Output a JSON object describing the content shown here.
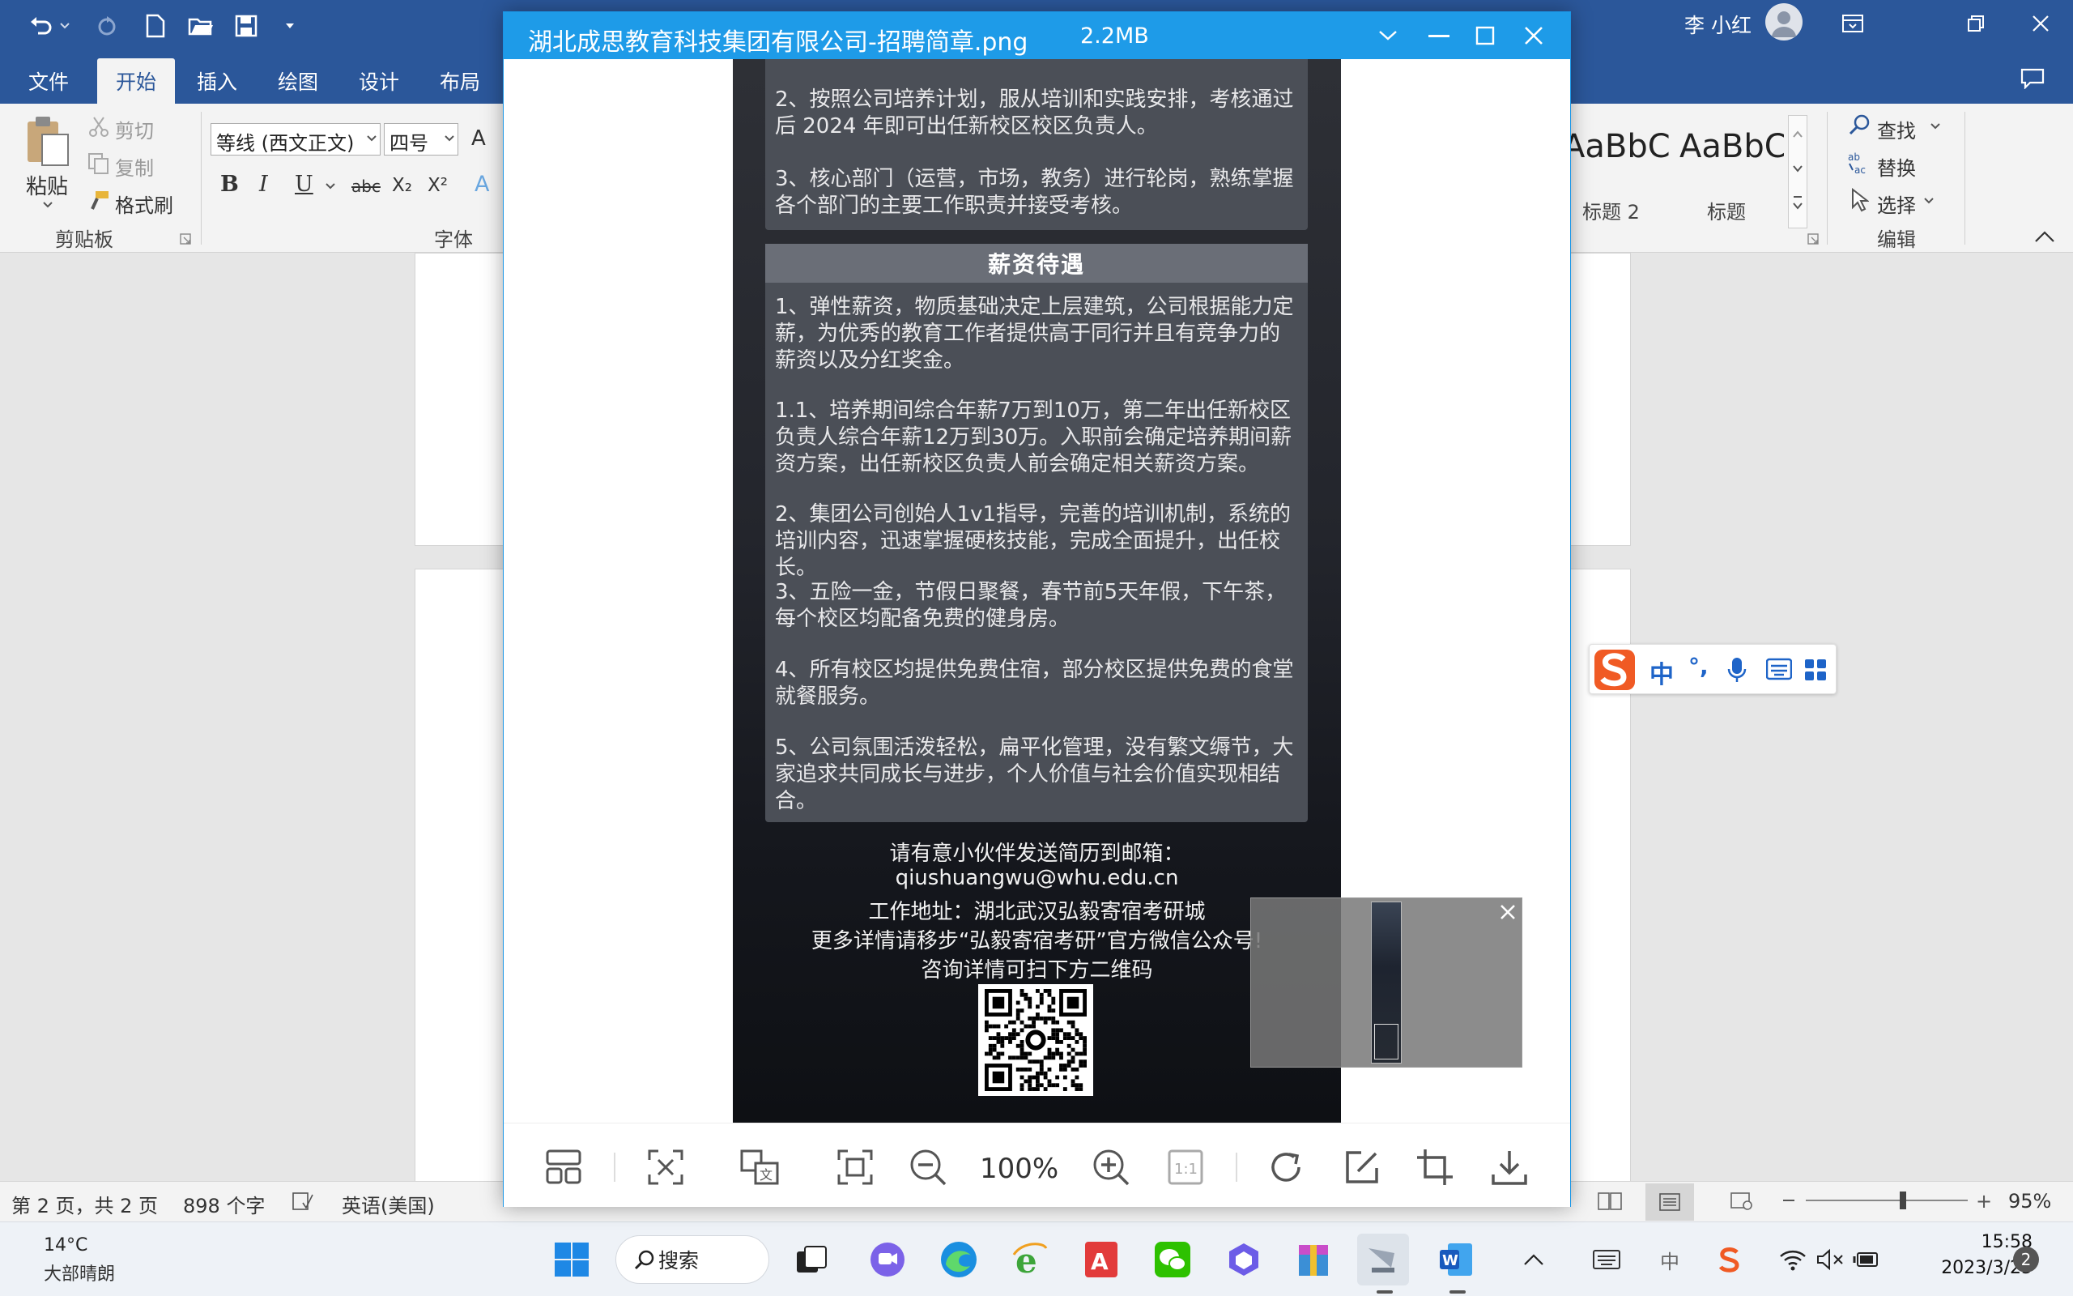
{
  "word": {
    "tabs": [
      "文件",
      "开始",
      "插入",
      "绘图",
      "设计",
      "布局"
    ],
    "active_tab": "开始",
    "user_name": "李 小红",
    "clipboard": {
      "paste": "粘贴",
      "cut": "剪切",
      "copy": "复制",
      "format_painter": "格式刷",
      "group_label": "剪贴板"
    },
    "font": {
      "font_name": "等线 (西文正文)",
      "font_size": "四号",
      "group_label": "字体",
      "grow_label": "A",
      "bold": "B",
      "italic": "I",
      "underline": "U",
      "strike": "abc",
      "sub": "X₂",
      "sup": "X²",
      "effects": "A"
    },
    "styles": [
      {
        "preview": "AaBbC",
        "name": "标题 2"
      },
      {
        "preview": "AaBbC",
        "name": "标题"
      }
    ],
    "editing": {
      "find": "查找",
      "replace": "替换",
      "select": "选择",
      "group_label": "编辑"
    }
  },
  "status": {
    "page": "第 2 页，共 2 页",
    "words": "898 个字",
    "language": "英语(美国)",
    "zoom": "95%",
    "zoom_fraction": 0.6
  },
  "viewer": {
    "title": "湖北成思教育科技集团有限公司-招聘简章.png",
    "filesize": "2.2MB",
    "zoom": "100%",
    "poster": {
      "top_items": [
        "2、按照公司培养计划，服从培训和实践安排，考核通过后 2024 年即可出任新校区校区负责人。",
        "3、核心部门（运营，市场，教务）进行轮岗，熟练掌握各个部门的主要工作职责并接受考核。"
      ],
      "salary_title": "薪资待遇",
      "salary_items": [
        "1、弹性薪资，物质基础决定上层建筑，公司根据能力定薪，为优秀的教育工作者提供高于同行并且有竞争力的薪资以及分红奖金。",
        "1.1、培养期间综合年薪7万到10万，第二年出任新校区负责人综合年薪12万到30万。入职前会确定培养期间薪资方案，出任新校区负责人前会确定相关薪资方案。",
        "2、集团公司创始人1v1指导，完善的培训机制，系统的培训内容，迅速掌握硬核技能，完成全面提升，出任校长。",
        "3、五险一金，节假日聚餐，春节前5天年假，下午茶，每个校区均配备免费的健身房。",
        "4、所有校区均提供免费住宿，部分校区提供免费的食堂就餐服务。",
        "5、公司氛围活泼轻松，扁平化管理，没有繁文缛节，大家追求共同成长与进步，个人价值与社会价值实现相结合。"
      ],
      "contact": [
        "请有意小伙伴发送简历到邮箱：",
        "qiushuangwu@whu.edu.cn",
        "工作地址：湖北武汉弘毅寄宿考研城",
        "更多详情请移步“弘毅寄宿考研”官方微信公众号!",
        "咨询详情可扫下方二维码"
      ]
    }
  },
  "ime": {
    "mode": "中",
    "punct": "°,"
  },
  "taskbar": {
    "weather_temp": "14°C",
    "weather_desc": "大部晴朗",
    "search": "搜索",
    "time": "15:58",
    "date": "2023/3/25",
    "notifications": "2",
    "input_lang": "中"
  },
  "colors": {
    "word_blue": "#2b579a",
    "viewer_blue": "#1e9be8"
  }
}
